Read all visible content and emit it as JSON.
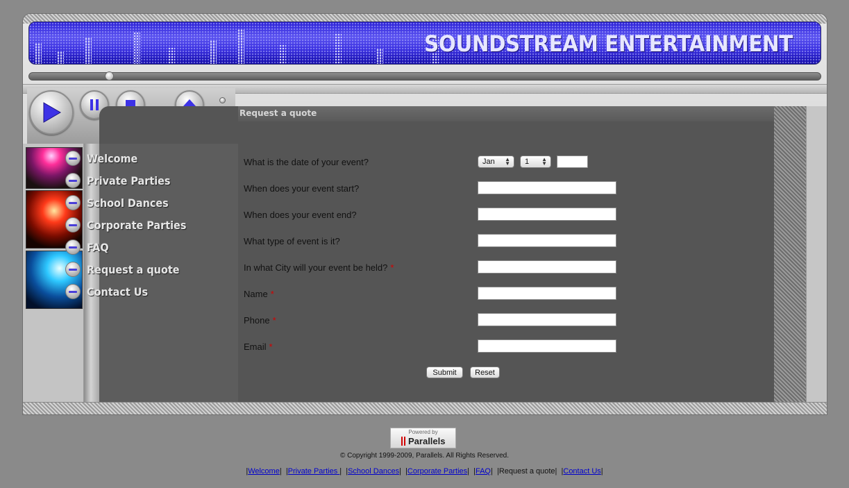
{
  "header": {
    "title": "SOUNDSTREAM ENTERTAINMENT"
  },
  "player": {
    "seek_position": 0.1
  },
  "nav": {
    "items": [
      {
        "label": "Welcome"
      },
      {
        "label": "Private Parties"
      },
      {
        "label": "School Dances"
      },
      {
        "label": "Corporate Parties"
      },
      {
        "label": "FAQ"
      },
      {
        "label": "Request a quote"
      },
      {
        "label": "Contact Us"
      }
    ]
  },
  "page": {
    "heading": "Request a quote"
  },
  "form": {
    "date_label": "What is the date of your event?",
    "month_value": "Jan",
    "day_value": "1",
    "year_value": "",
    "start_label": "When does your event start?",
    "end_label": "When does your event end?",
    "type_label": "What type of event is it?",
    "city_label": "In what City will your event be held?",
    "name_label": "Name",
    "phone_label": "Phone",
    "email_label": "Email",
    "required_mark": "*",
    "submit_label": "Submit",
    "reset_label": "Reset"
  },
  "footer": {
    "powered_by": "Powered by",
    "brand": "Parallels",
    "copyright": "© Copyright 1999-2009, Parallels. All Rights Reserved.",
    "links": [
      {
        "label": "Welcome"
      },
      {
        "label": "Private Parties "
      },
      {
        "label": "School Dances"
      },
      {
        "label": "Corporate Parties"
      },
      {
        "label": "FAQ"
      },
      {
        "label": "Request a quote"
      },
      {
        "label": "Contact Us"
      }
    ]
  },
  "colors": {
    "accent": "#3a30e0",
    "page_bg": "#8a8a8a",
    "content_bg": "#555555",
    "required": "#d40000"
  }
}
